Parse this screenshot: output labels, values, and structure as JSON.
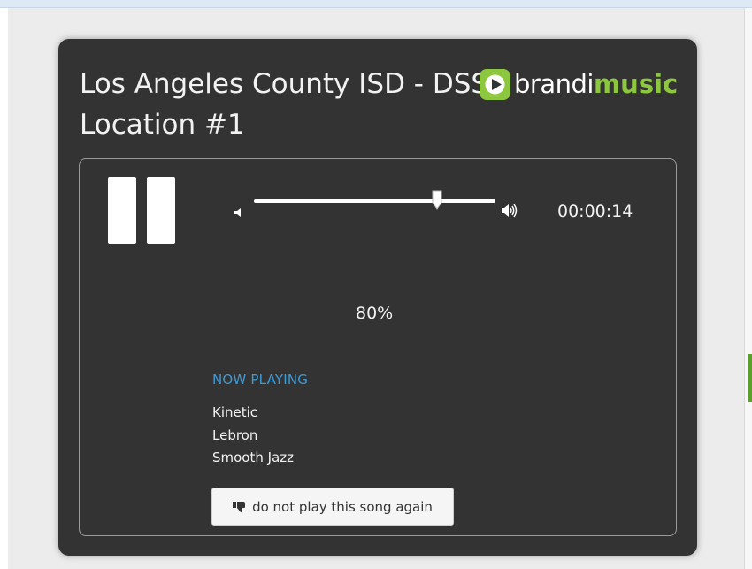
{
  "player": {
    "title_line1": "Los Angeles County ISD - DSS",
    "title_line2": "Location #1",
    "logo": {
      "brandi": "brandi",
      "music": "music",
      "accent_color": "#8dc63f"
    },
    "controls": {
      "play_state_icon": "pause-icon",
      "elapsed_time": "00:00:14",
      "volume_level": 0.76,
      "volume_percent": "80%",
      "volume_low_icon": "volume-low-icon",
      "volume_high_icon": "volume-high-icon"
    },
    "now_playing": {
      "label": "NOW PLAYING",
      "label_color": "#3c9ad6",
      "lines": [
        "Kinetic",
        "Lebron",
        "Smooth Jazz"
      ]
    },
    "dislike_button": {
      "label": "do not play this song again",
      "icon": "thumbs-down-icon"
    }
  }
}
